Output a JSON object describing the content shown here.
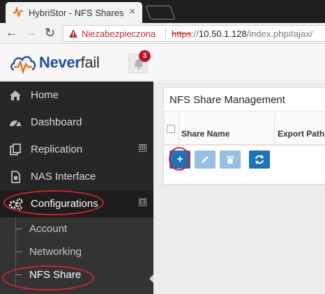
{
  "browser": {
    "tab_title": "HybriStor - NFS Shares",
    "tab_close": "×",
    "security_label": "Niezabezpieczona",
    "url_scheme": "https",
    "url_sep": "://",
    "url_host": "10.50.1.128",
    "url_path": "/index.php#ajax/"
  },
  "header": {
    "brand_bold": "Never",
    "brand_light": "fail",
    "notification_count": "3"
  },
  "sidebar": {
    "items": [
      {
        "label": "Home",
        "icon": "home-icon"
      },
      {
        "label": "Dashboard",
        "icon": "dashboard-icon"
      },
      {
        "label": "Replication",
        "icon": "replication-icon",
        "expand": "⊞"
      },
      {
        "label": "NAS Interface",
        "icon": "nas-interface-icon"
      },
      {
        "label": "Configurations",
        "icon": "configurations-icon",
        "expand": "⊟"
      }
    ],
    "subitems": [
      {
        "label": "Account"
      },
      {
        "label": "Networking"
      },
      {
        "label": "NFS Share"
      }
    ]
  },
  "panel": {
    "title": "NFS Share Management",
    "columns": [
      "Share Name",
      "Export Path"
    ],
    "buttons": {
      "add": "+",
      "edit": "pencil-icon",
      "delete": "trash-icon",
      "refresh": "refresh-icon"
    }
  },
  "colors": {
    "accent": "#1e72b8",
    "sidebar": "#272727",
    "annotation": "#d51f2f",
    "brand": "#1e4fa0",
    "warning": "#c62828"
  }
}
